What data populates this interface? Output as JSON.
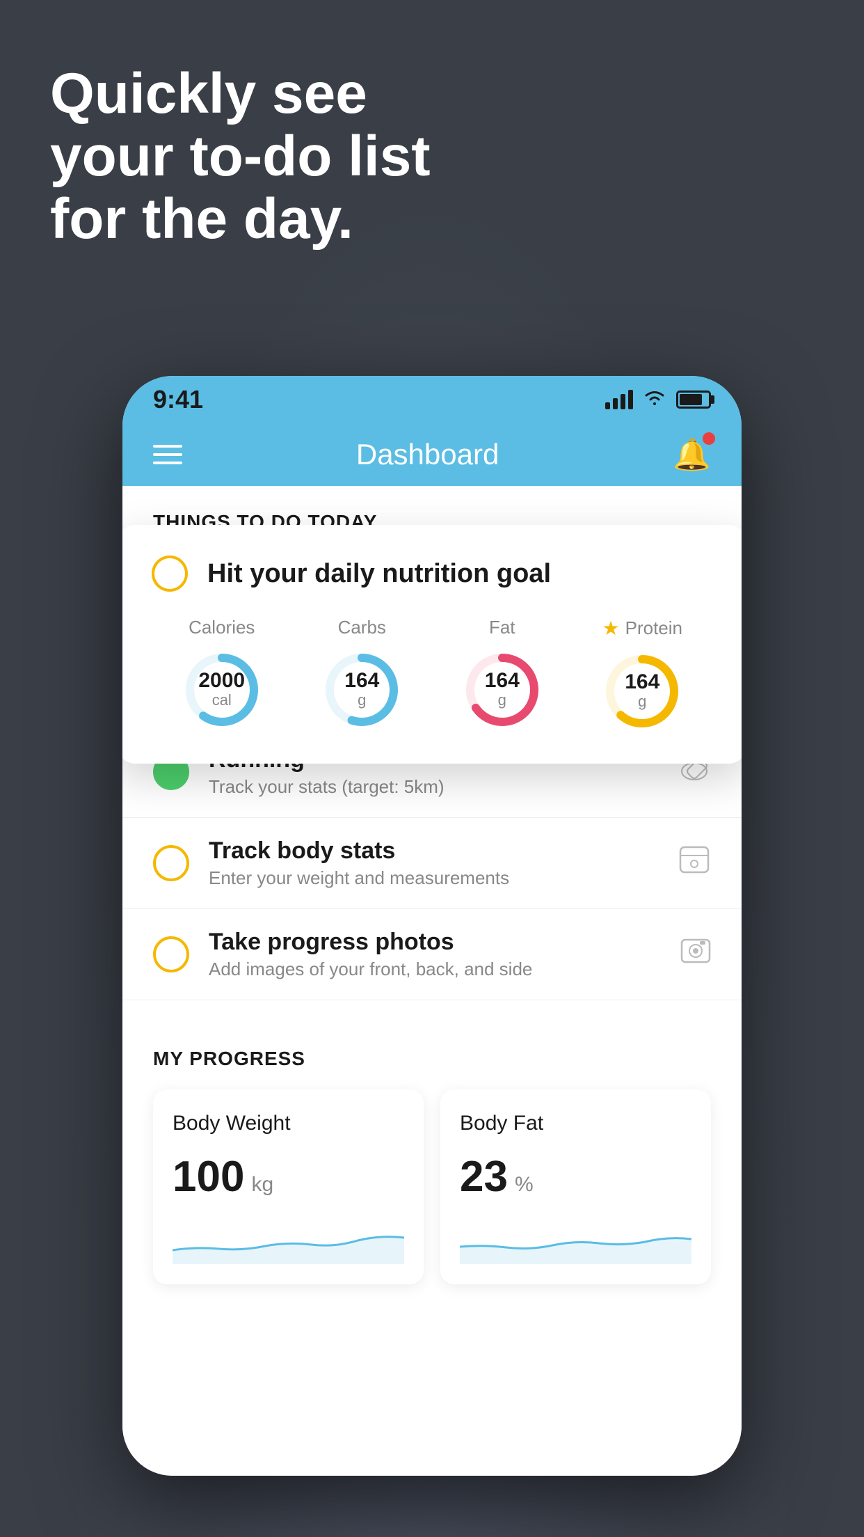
{
  "headline": {
    "line1": "Quickly see",
    "line2": "your to-do list",
    "line3": "for the day."
  },
  "status_bar": {
    "time": "9:41"
  },
  "nav": {
    "title": "Dashboard"
  },
  "things_header": "THINGS TO DO TODAY",
  "floating_card": {
    "title": "Hit your daily nutrition goal",
    "nutrition": [
      {
        "label": "Calories",
        "value": "2000",
        "unit": "cal",
        "color": "#5bbde4",
        "progress": 60
      },
      {
        "label": "Carbs",
        "value": "164",
        "unit": "g",
        "color": "#5bbde4",
        "progress": 55
      },
      {
        "label": "Fat",
        "value": "164",
        "unit": "g",
        "color": "#e84a6f",
        "progress": 70
      },
      {
        "label": "Protein",
        "value": "164",
        "unit": "g",
        "color": "#f5b800",
        "progress": 65,
        "starred": true
      }
    ]
  },
  "tasks": [
    {
      "name": "Running",
      "sub": "Track your stats (target: 5km)",
      "status": "done",
      "icon": "👟"
    },
    {
      "name": "Track body stats",
      "sub": "Enter your weight and measurements",
      "status": "pending",
      "icon": "⚖"
    },
    {
      "name": "Take progress photos",
      "sub": "Add images of your front, back, and side",
      "status": "pending",
      "icon": "🖼"
    }
  ],
  "progress": {
    "title": "MY PROGRESS",
    "cards": [
      {
        "title": "Body Weight",
        "value": "100",
        "unit": "kg"
      },
      {
        "title": "Body Fat",
        "value": "23",
        "unit": "%"
      }
    ]
  }
}
